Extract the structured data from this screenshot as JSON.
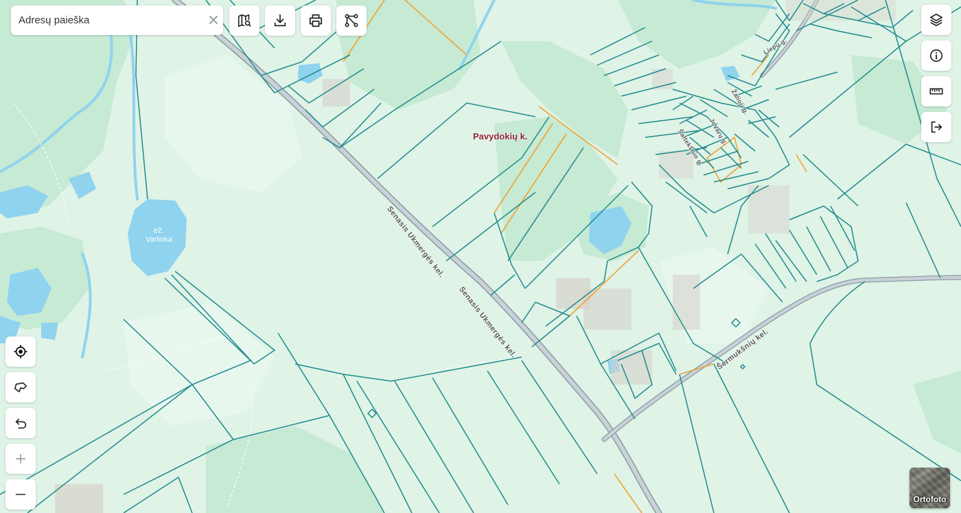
{
  "search": {
    "placeholder": "Adresų paieška"
  },
  "top_toolbar": [
    {
      "name": "map-search-button",
      "icon": "map-search-icon"
    },
    {
      "name": "download-button",
      "icon": "download-icon"
    },
    {
      "name": "print-button",
      "icon": "printer-icon"
    },
    {
      "name": "route-button",
      "icon": "route-icon"
    }
  ],
  "right_toolbar": [
    {
      "name": "layers-button",
      "icon": "layers-icon"
    },
    {
      "name": "info-button",
      "icon": "info-icon"
    },
    {
      "name": "measure-button",
      "icon": "ruler-icon"
    },
    {
      "name": "logout-button",
      "icon": "logout-icon"
    }
  ],
  "left_toolbar": [
    {
      "name": "locate-button",
      "icon": "target-icon"
    },
    {
      "name": "draw-polygon-button",
      "icon": "polygon-icon"
    },
    {
      "name": "undo-button",
      "icon": "undo-icon"
    },
    {
      "name": "zoom-in-button",
      "icon": "plus-icon"
    },
    {
      "name": "zoom-out-button",
      "icon": "minus-icon"
    }
  ],
  "map": {
    "place_labels": [
      {
        "name": "village-label",
        "text": "Pavydokių k."
      },
      {
        "name": "lake-label-line1",
        "text": "ež."
      },
      {
        "name": "lake-label-line2",
        "text": "Varlinka"
      }
    ],
    "road_labels": [
      {
        "name": "road-label-1",
        "text": "Senasis Ukmergės kel."
      },
      {
        "name": "road-label-2",
        "text": "Senasis Ukmergės kel."
      },
      {
        "name": "road-label-3",
        "text": "Šermukšnių kel."
      },
      {
        "name": "road-label-4",
        "text": "Šaltekšnio g."
      },
      {
        "name": "road-label-5",
        "text": "Liepų g."
      },
      {
        "name": "road-label-6",
        "text": "Žalioji g."
      },
      {
        "name": "road-label-7",
        "text": "Jovarų g."
      }
    ],
    "colors": {
      "land": "#dff3e6",
      "forest": "#c6ead3",
      "water": "#8fd3ef",
      "parcel_line": "#1e8a8d",
      "parcel_highlight": "#f0a232",
      "road": "#a9b6bf",
      "village_label": "#8b2331",
      "building": "#d5d2cb"
    }
  },
  "basemap_switch": {
    "label": "Ortofoto"
  }
}
